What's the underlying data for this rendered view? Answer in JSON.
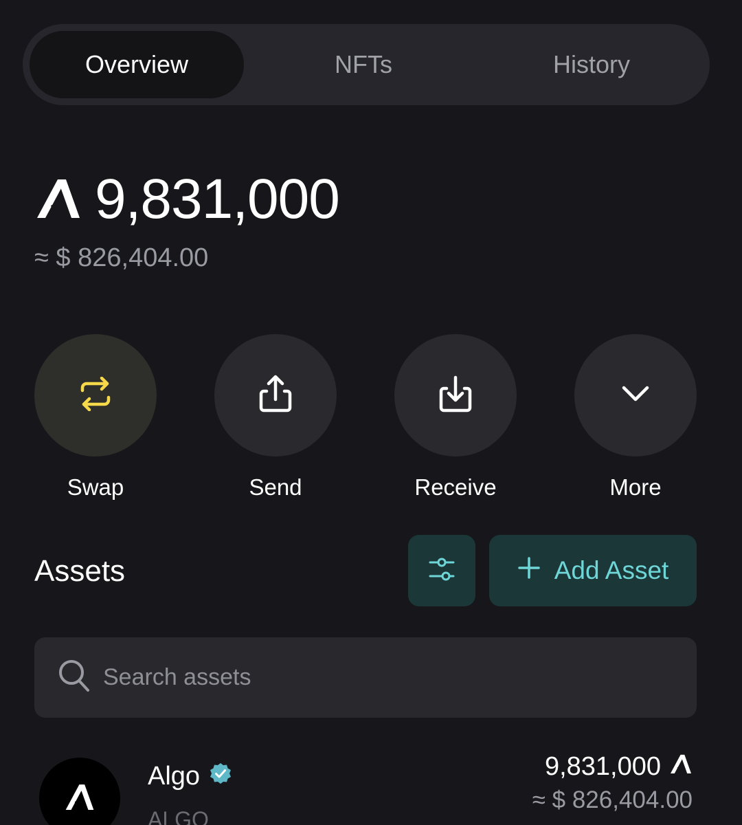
{
  "tabs": [
    {
      "label": "Overview",
      "active": true
    },
    {
      "label": "NFTs",
      "active": false
    },
    {
      "label": "History",
      "active": false
    }
  ],
  "balance": {
    "currency_icon": "algo-icon",
    "amount": "9,831,000",
    "usd": "≈ $ 826,404.00"
  },
  "actions": [
    {
      "label": "Swap",
      "icon": "swap-icon",
      "accent": "#f5d94a"
    },
    {
      "label": "Send",
      "icon": "send-icon"
    },
    {
      "label": "Receive",
      "icon": "receive-icon"
    },
    {
      "label": "More",
      "icon": "chevron-down-icon"
    }
  ],
  "assets": {
    "title": "Assets",
    "filter_icon": "filter-sliders-icon",
    "add_label": "Add Asset",
    "search_placeholder": "Search assets",
    "items": [
      {
        "name": "Algo",
        "verified": true,
        "ticker": "ALGO",
        "amount": "9,831,000",
        "usd": "≈ $ 826,404.00"
      }
    ]
  },
  "colors": {
    "background": "#16161b",
    "accent_teal": "#6fd6d8",
    "swap_yellow": "#f5d94a",
    "verified_badge": "#5fb8c8"
  }
}
